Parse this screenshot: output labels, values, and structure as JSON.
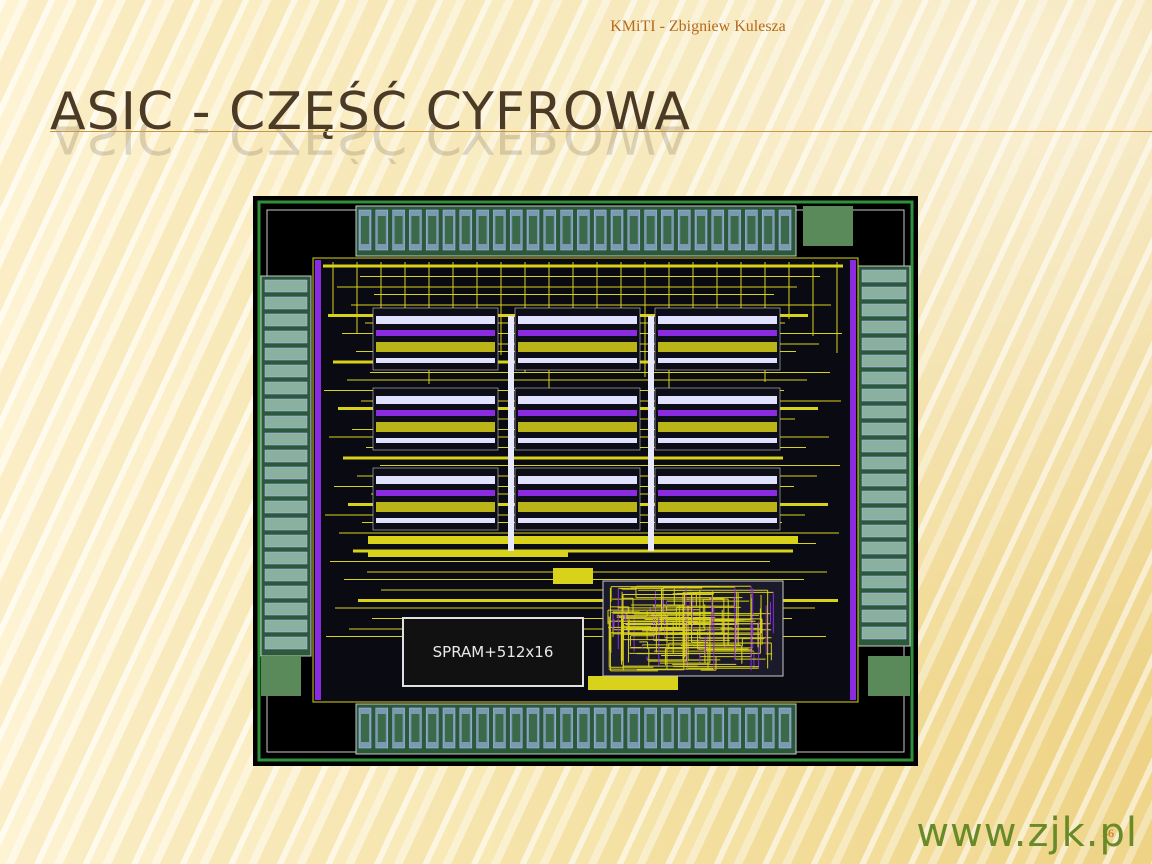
{
  "slide": {
    "header": "KMiTI - Zbigniew Kulesza",
    "title": "ASIC - CZĘŚĆ CYFROWA",
    "page_number": "56",
    "footer_url": "www.zjk.pl"
  },
  "layout_image": {
    "block_label": "SPRAM+512x16"
  },
  "colors": {
    "title": "#4a3a26",
    "header": "#b56a1e",
    "footer": "#6a8a2a",
    "metal_yellow": "#d9d21a",
    "metal_purple": "#8a2be2",
    "pad_green": "#2f8f3a"
  }
}
